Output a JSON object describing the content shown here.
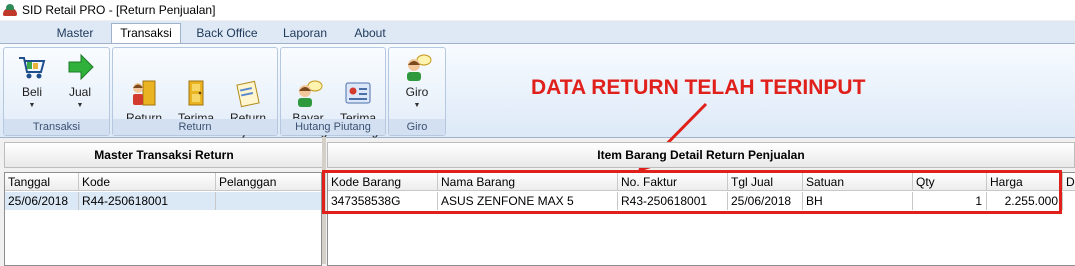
{
  "window": {
    "title": "SID Retail PRO - [Return Penjualan]"
  },
  "menu_tabs": [
    "Master",
    "Transaksi",
    "Back Office",
    "Laporan",
    "About"
  ],
  "ribbon": {
    "groups": [
      {
        "label": "Transaksi",
        "buttons": [
          {
            "label": "Beli",
            "icon": "cart-icon"
          },
          {
            "label": "Jual",
            "icon": "green-arrow-icon"
          }
        ]
      },
      {
        "label": "Return",
        "buttons": [
          {
            "label": "Return\nPembelian",
            "icon": "person-door-icon"
          },
          {
            "label": "Terima\nReturn",
            "icon": "door-icon"
          },
          {
            "label": "Return\nPenjualan",
            "icon": "document-icon"
          }
        ]
      },
      {
        "label": "Hutang Piutang",
        "buttons": [
          {
            "label": "Bayar\nHutang",
            "icon": "person-speech-icon"
          },
          {
            "label": "Terima\nPiutang",
            "icon": "card-icon"
          }
        ]
      },
      {
        "label": "Giro",
        "buttons": [
          {
            "label": "Giro",
            "icon": "person-speech-icon"
          }
        ]
      }
    ]
  },
  "annotation": {
    "text": "DATA RETURN TELAH TERINPUT",
    "color": "#e0201b"
  },
  "left_panel": {
    "title": "Master Transaksi Return",
    "columns": [
      "Tanggal",
      "Kode",
      "Pelanggan"
    ],
    "rows": [
      [
        "25/06/2018",
        "R44-250618001",
        ""
      ]
    ]
  },
  "right_panel": {
    "title": "Item Barang Detail Return Penjualan",
    "columns": [
      "Kode Barang",
      "Nama Barang",
      "No. Faktur",
      "Tgl Jual",
      "Satuan",
      "Qty",
      "Harga",
      "D"
    ],
    "rows": [
      [
        "347358538G",
        "ASUS ZENFONE MAX 5",
        "R43-250618001",
        "25/06/2018",
        "BH",
        "1",
        "2.255.000"
      ]
    ]
  }
}
